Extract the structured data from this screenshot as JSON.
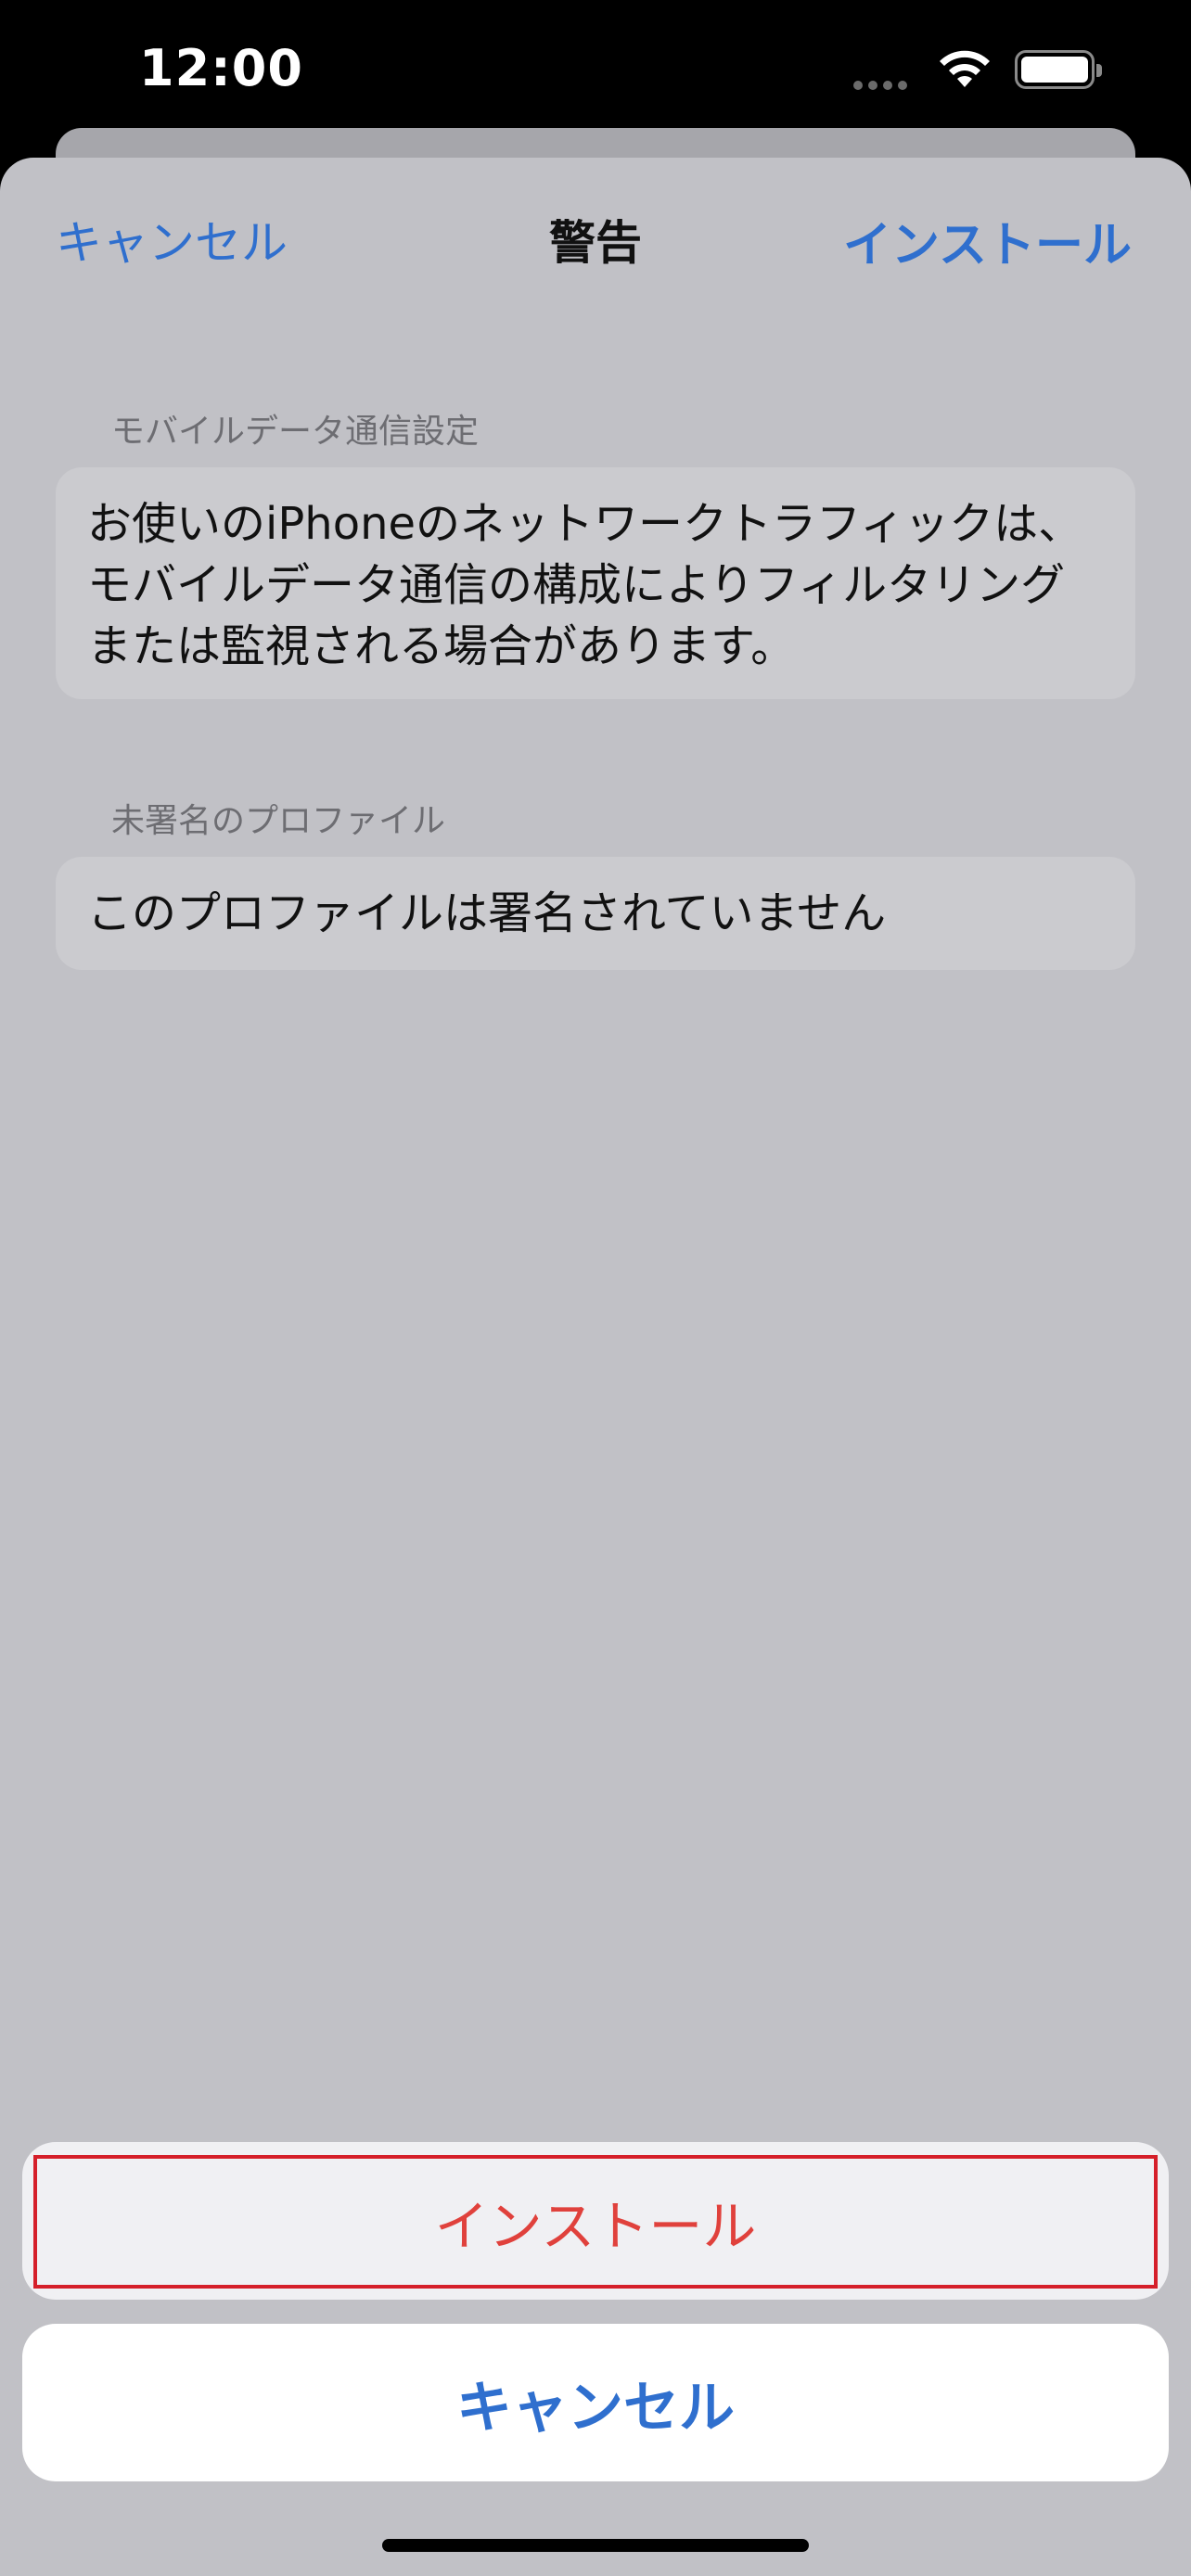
{
  "status_bar": {
    "time": "12:00"
  },
  "nav": {
    "cancel_label": "キャンセル",
    "title": "警告",
    "install_label": "インストール"
  },
  "sections": [
    {
      "header": "モバイルデータ通信設定",
      "body": "お使いのiPhoneのネットワークトラフィックは、モバイルデータ通信の構成によりフィルタリングまたは監視される場合があります。"
    },
    {
      "header": "未署名のプロファイル",
      "body": "このプロファイルは署名されていません"
    }
  ],
  "action_sheet": {
    "install_label": "インストール",
    "cancel_label": "キャンセル"
  },
  "colors": {
    "accent_blue": "#2f6fce",
    "destructive_red": "#e0413c",
    "highlight_border": "#d51f2a",
    "sheet_background": "#c1c1c6"
  },
  "icons": [
    "cellular-signal-icon",
    "wifi-icon",
    "battery-icon"
  ]
}
